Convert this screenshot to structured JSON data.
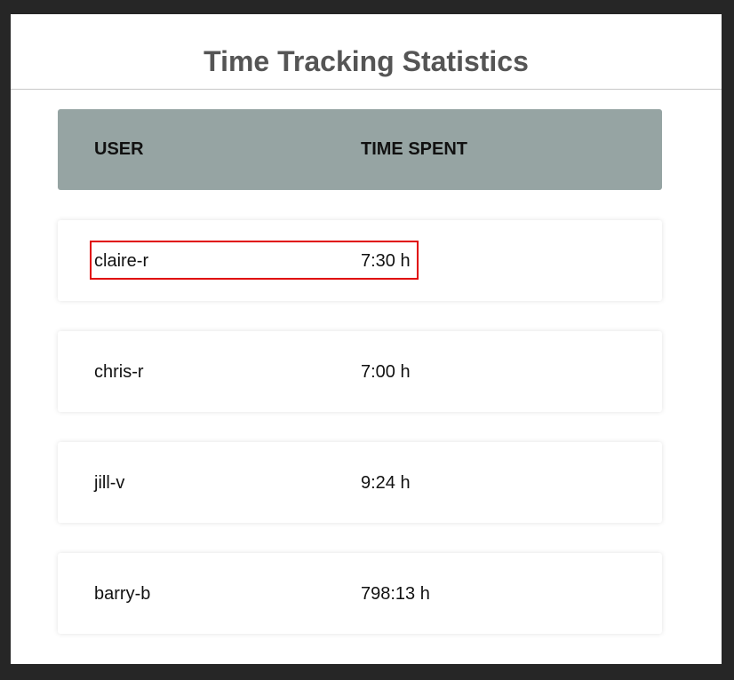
{
  "page": {
    "title": "Time Tracking Statistics"
  },
  "table": {
    "headers": {
      "user": "USER",
      "time_spent": "TIME SPENT"
    },
    "rows": [
      {
        "user": "claire-r",
        "time": "7:30 h"
      },
      {
        "user": "chris-r",
        "time": "7:00 h"
      },
      {
        "user": "jill-v",
        "time": "9:24 h"
      },
      {
        "user": "barry-b",
        "time": "798:13 h"
      }
    ]
  },
  "colors": {
    "header_bg": "#96a4a3",
    "highlight_border": "#e00000",
    "title_color": "#555555"
  }
}
